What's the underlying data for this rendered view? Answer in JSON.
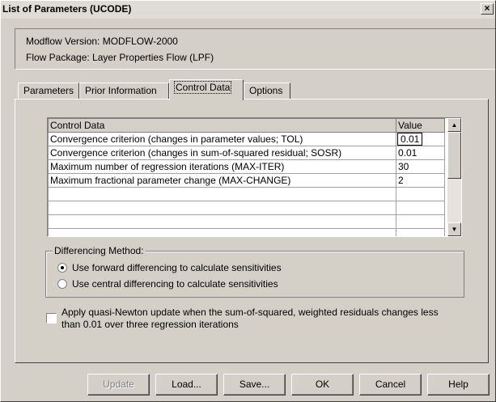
{
  "window": {
    "title": "List of Parameters (UCODE)",
    "close_glyph": "×"
  },
  "info": {
    "modflow_version": "Modflow Version: MODFLOW-2000",
    "flow_package": "Flow Package: Layer Properties Flow (LPF)"
  },
  "tabs": [
    {
      "label": "Parameters",
      "active": false
    },
    {
      "label": "Prior Information",
      "active": false
    },
    {
      "label": "Control Data",
      "active": true
    },
    {
      "label": "Options",
      "active": false
    }
  ],
  "grid": {
    "columns": [
      "Control Data",
      "Value"
    ],
    "rows": [
      {
        "name": "Convergence criterion (changes in parameter values; TOL)",
        "value": "0.01"
      },
      {
        "name": "Convergence criterion (changes in sum-of-squared residual; SOSR)",
        "value": "0.01"
      },
      {
        "name": "Maximum number of regression iterations (MAX-ITER)",
        "value": "30"
      },
      {
        "name": "Maximum fractional parameter change (MAX-CHANGE)",
        "value": "2"
      }
    ]
  },
  "differencing": {
    "legend": "Differencing Method:",
    "options": [
      {
        "label": "Use forward differencing to calculate sensitivities",
        "selected": true
      },
      {
        "label": "Use central differencing to calculate sensitivities",
        "selected": false
      }
    ]
  },
  "quasi_newton": {
    "label": "Apply quasi-Newton update when the sum-of-squared, weighted residuals changes less than 0.01 over three regression iterations",
    "checked": false
  },
  "buttons": {
    "update": "Update",
    "load": "Load...",
    "save": "Save...",
    "ok": "OK",
    "cancel": "Cancel",
    "help": "Help"
  }
}
